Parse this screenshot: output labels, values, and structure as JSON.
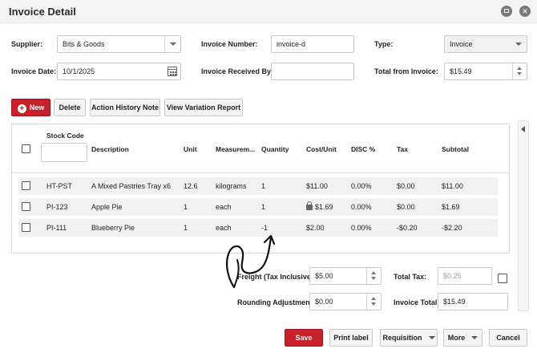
{
  "window": {
    "title": "Invoice Detail"
  },
  "header": {
    "supplier_label": "Supplier:",
    "supplier_value": "Bits & Goods",
    "invoice_number_label": "Invoice Number:",
    "invoice_number_value": "invoice-d",
    "type_label": "Type:",
    "type_value": "Invoice",
    "invoice_date_label": "Invoice Date:",
    "invoice_date_value": "10/1/2025",
    "received_by_label": "Invoice Received By:",
    "received_by_value": "",
    "total_from_invoice_label": "Total from Invoice:",
    "total_from_invoice_value": "$15.49"
  },
  "toolbar": {
    "new_label": "New",
    "delete_label": "Delete",
    "action_history_label": "Action History Note",
    "view_variation_label": "View Variation Report"
  },
  "table": {
    "columns": [
      "Stock Code",
      "Description",
      "Unit",
      "Measurem...",
      "Quantity",
      "Cost/Unit",
      "DISC %",
      "Tax",
      "Subtotal"
    ],
    "rows": [
      {
        "code": "HT-PST",
        "description": "A Mixed Pastries Tray x6",
        "unit": "12.6",
        "measure": "kilograms",
        "quantity": "1",
        "cost": "$11.00",
        "locked": false,
        "disc": "0.00%",
        "tax": "$0.00",
        "subtotal": "$11.00"
      },
      {
        "code": "PI-123",
        "description": "Apple Pie",
        "unit": "1",
        "measure": "each",
        "quantity": "1",
        "cost": "$1.69",
        "locked": true,
        "disc": "0.00%",
        "tax": "$0.00",
        "subtotal": "$1.69"
      },
      {
        "code": "PI-111",
        "description": "Blueberry Pie",
        "unit": "1",
        "measure": "each",
        "quantity": "-1",
        "cost": "$2.00",
        "locked": false,
        "disc": "0.00%",
        "tax": "-$0.20",
        "subtotal": "-$2.20"
      }
    ]
  },
  "totals": {
    "freight_label": "Freight (Tax Inclusive):",
    "freight_value": "$5.00",
    "total_tax_label": "Total Tax:",
    "total_tax_value": "$0.25",
    "rounding_label": "Rounding Adjustment:",
    "rounding_value": "$0.00",
    "invoice_total_label": "Invoice Total:",
    "invoice_total_value": "$15.49"
  },
  "footer": {
    "save_label": "Save",
    "print_label": "Print label",
    "requisition_label": "Requisition",
    "more_label": "More",
    "cancel_label": "Cancel"
  },
  "colors": {
    "primary": "#c8202a",
    "text": "#222222",
    "border": "#c9c9c9",
    "row_bg": "#f1f1f1"
  },
  "icons": [
    "minimize-icon",
    "close-icon",
    "calendar-icon",
    "lock-icon",
    "plus-icon",
    "chevron-down-icon",
    "collapse-left-icon"
  ]
}
